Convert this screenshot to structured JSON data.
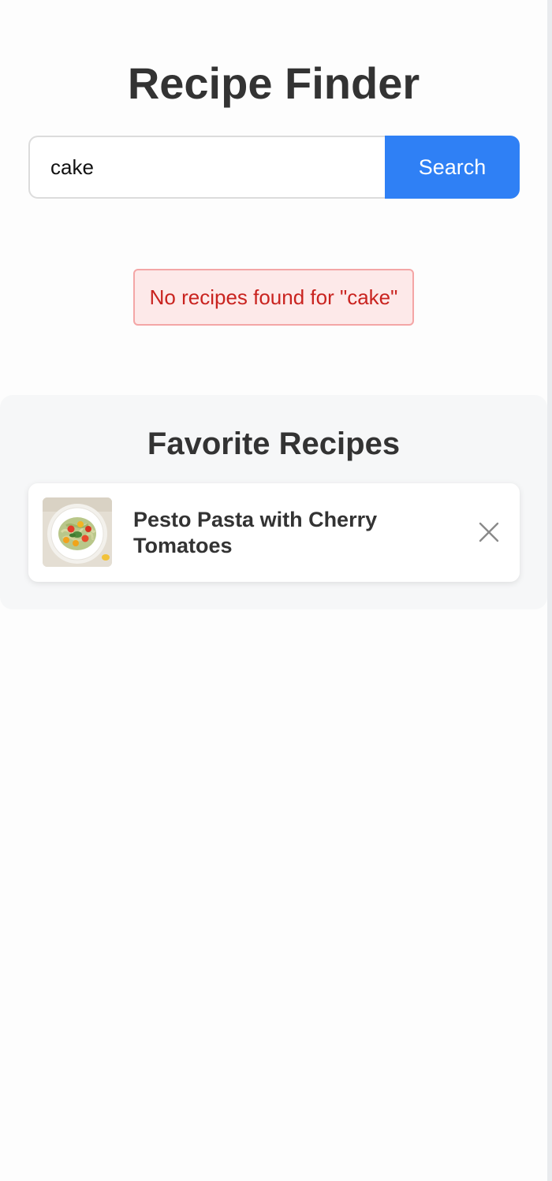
{
  "header": {
    "title": "Recipe Finder"
  },
  "search": {
    "value": "cake",
    "placeholder": "",
    "button_label": "Search"
  },
  "message": {
    "text": "No recipes found for \"cake\""
  },
  "favorites": {
    "title": "Favorite Recipes",
    "items": [
      {
        "name": "Pesto Pasta with Cherry Tomatoes",
        "remove_icon": "close-icon",
        "image": "pesto-pasta-photo"
      }
    ]
  },
  "colors": {
    "accent": "#2f80f5",
    "error_text": "#c9231f",
    "error_bg": "#fde9e9",
    "error_border": "#f4a6a6"
  }
}
